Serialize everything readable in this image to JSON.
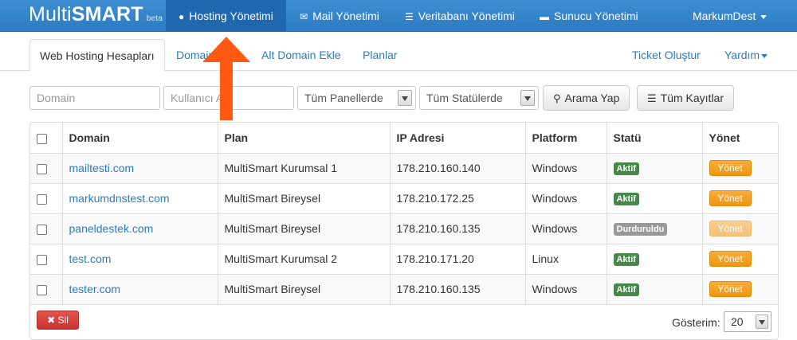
{
  "brand": {
    "main_a": "Multi",
    "main_b": "SMART",
    "badge": "beta"
  },
  "nav": {
    "hosting": "Hosting Yönetimi",
    "mail": "Mail Yönetimi",
    "database": "Veritabanı Yönetimi",
    "server": "Sunucu Yönetimi",
    "user": "MarkumDest"
  },
  "tabs": {
    "web_hosting": "Web Hosting Hesapları",
    "domain": "Domain",
    "subdomain": "Alt Domain Ekle",
    "plans": "Planlar",
    "ticket": "Ticket Oluştur",
    "help": "Yardım"
  },
  "filters": {
    "domain_placeholder": "Domain",
    "user_placeholder": "Kullanıcı Adı",
    "panels_selected": "Tüm Panellerde",
    "status_selected": "Tüm Statülerde",
    "search_label": "Arama Yap",
    "all_records_label": "Tüm Kayıtlar"
  },
  "table": {
    "headers": {
      "domain": "Domain",
      "plan": "Plan",
      "ip": "IP Adresi",
      "platform": "Platform",
      "status": "Statü",
      "manage": "Yönet"
    },
    "rows": [
      {
        "domain": "mailtesti.com",
        "plan": "MultiSmart Kurumsal 1",
        "ip": "178.210.160.140",
        "platform": "Windows",
        "status": "Aktif",
        "manage": "Yönet"
      },
      {
        "domain": "markumdnstest.com",
        "plan": "MultiSmart Bireysel",
        "ip": "178.210.172.25",
        "platform": "Windows",
        "status": "Aktif",
        "manage": "Yönet"
      },
      {
        "domain": "paneldestek.com",
        "plan": "MultiSmart Bireysel",
        "ip": "178.210.160.135",
        "platform": "Windows",
        "status": "Durduruldu",
        "manage": "Yönet"
      },
      {
        "domain": "test.com",
        "plan": "MultiSmart Kurumsal 2",
        "ip": "178.210.171.20",
        "platform": "Linux",
        "status": "Aktif",
        "manage": "Yönet"
      },
      {
        "domain": "tester.com",
        "plan": "MultiSmart Bireysel",
        "ip": "178.210.160.135",
        "platform": "Windows",
        "status": "Aktif",
        "manage": "Yönet"
      }
    ]
  },
  "footer": {
    "delete_label": "Sil",
    "show_label": "Gösterim:",
    "page_size": "20"
  },
  "colors": {
    "navbar": "#2d7bc2",
    "link": "#2a7dc0",
    "status_active": "#468847",
    "status_stopped": "#999999",
    "manage_button": "#f0960f",
    "delete_button": "#c9302c",
    "annotation_arrow": "#ff5a14"
  },
  "icons": {
    "hosting": "globe-icon",
    "mail": "envelope-icon",
    "database": "list-icon",
    "server": "hdd-icon",
    "search": "search-icon",
    "all_records": "list-icon",
    "delete": "close-icon"
  }
}
